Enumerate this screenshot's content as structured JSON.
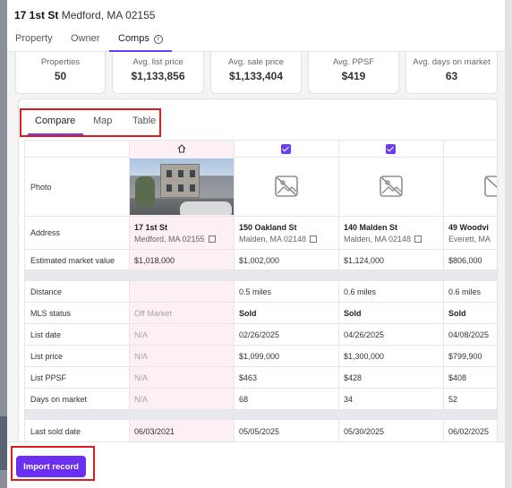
{
  "header": {
    "street": "17 1st St",
    "city_line": "Medford, MA 02155"
  },
  "top_tabs": [
    {
      "label": "Property"
    },
    {
      "label": "Owner"
    },
    {
      "label": "Comps"
    }
  ],
  "info_icon": "ⓘ",
  "stats": [
    {
      "label": "Properties",
      "value": "50"
    },
    {
      "label": "Avg. list price",
      "value": "$1,133,856"
    },
    {
      "label": "Avg. sale price",
      "value": "$1,133,404"
    },
    {
      "label": "Avg. PPSF",
      "value": "$419"
    },
    {
      "label": "Avg. days on market",
      "value": "63"
    }
  ],
  "sub_tabs": [
    {
      "label": "Compare"
    },
    {
      "label": "Map"
    },
    {
      "label": "Table"
    }
  ],
  "rows": {
    "photo": "Photo",
    "address": "Address",
    "est_value": "Estimated market value",
    "distance": "Distance",
    "mls": "MLS status",
    "list_date": "List date",
    "list_price": "List price",
    "list_ppsf": "List PPSF",
    "dom": "Days on market",
    "last_sold": "Last sold date"
  },
  "columns": [
    {
      "street": "17 1st St",
      "city": "Medford, MA 02155",
      "est_value": "$1,018,000",
      "distance": "",
      "mls": "Off Market",
      "list_date": "N/A",
      "list_price": "N/A",
      "list_ppsf": "N/A",
      "dom": "N/A",
      "last_sold": "06/03/2021"
    },
    {
      "street": "150 Oakland St",
      "city": "Malden, MA 02148",
      "est_value": "$1,002,000",
      "distance": "0.5 miles",
      "mls": "Sold",
      "list_date": "02/26/2025",
      "list_price": "$1,099,000",
      "list_ppsf": "$463",
      "dom": "68",
      "last_sold": "05/05/2025"
    },
    {
      "street": "140 Malden St",
      "city": "Malden, MA 02148",
      "est_value": "$1,124,000",
      "distance": "0.6 miles",
      "mls": "Sold",
      "list_date": "04/26/2025",
      "list_price": "$1,300,000",
      "list_ppsf": "$428",
      "dom": "34",
      "last_sold": "05/30/2025"
    },
    {
      "street": "49 Woodvi",
      "city": "Everett, MA",
      "est_value": "$806,000",
      "distance": "0.6 miles",
      "mls": "Sold",
      "list_date": "04/08/2025",
      "list_price": "$799,900",
      "list_ppsf": "$408",
      "dom": "52",
      "last_sold": "06/02/2025"
    }
  ],
  "footer": {
    "import_label": "Import record"
  },
  "colors": {
    "accent": "#6b2ff2",
    "highlight": "#e01b1b",
    "subject_column": "#fdf0f4"
  }
}
